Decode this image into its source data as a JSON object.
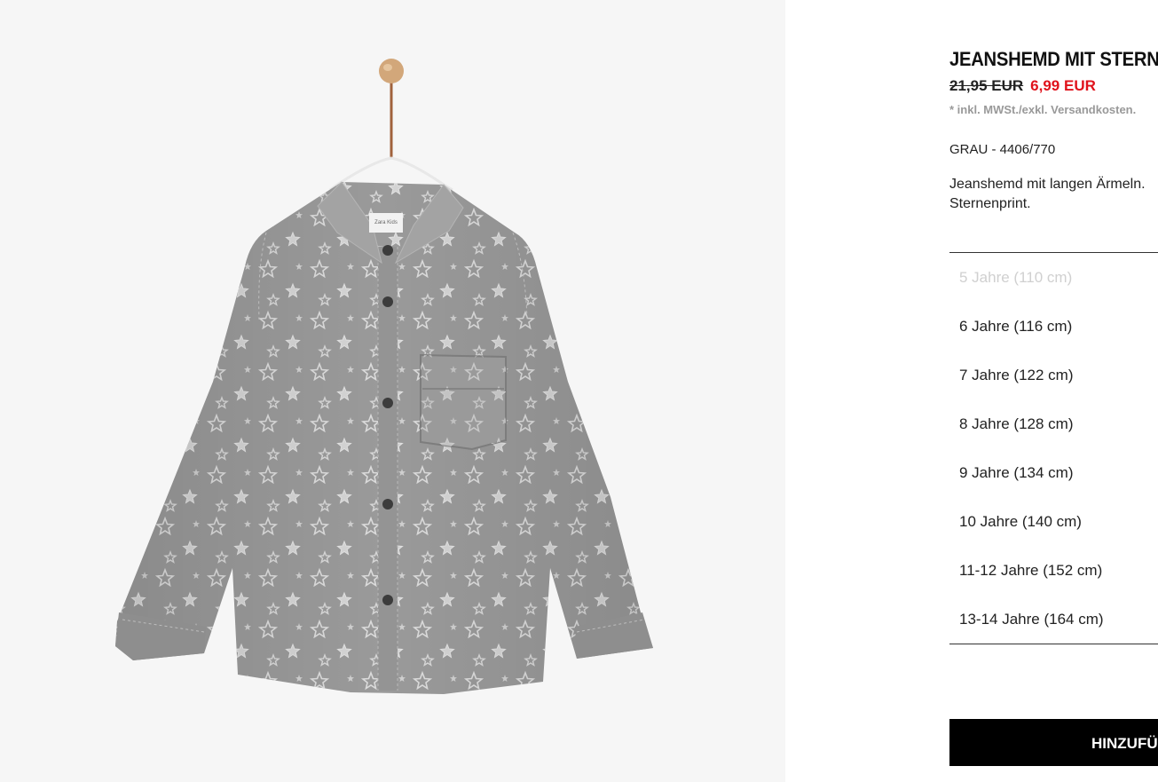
{
  "product": {
    "title": "JEANSHEMD MIT STERNEN",
    "old_price": "21,95 EUR",
    "new_price": "6,99 EUR",
    "tax_note": "* inkl. MWSt./exkl. Versandkosten.",
    "color_ref": "GRAU - 4406/770",
    "description": "Jeanshemd mit langen Ärmeln. Sternenprint.",
    "label_text": "Zara Kids"
  },
  "sizes": [
    {
      "label": "5 Jahre (110 cm)",
      "available": false
    },
    {
      "label": "6 Jahre (116 cm)",
      "available": true
    },
    {
      "label": "7 Jahre (122 cm)",
      "available": true
    },
    {
      "label": "8 Jahre (128 cm)",
      "available": true
    },
    {
      "label": "9 Jahre (134 cm)",
      "available": true
    },
    {
      "label": "10 Jahre (140 cm)",
      "available": true
    },
    {
      "label": "11-12 Jahre (152 cm)",
      "available": true
    },
    {
      "label": "13-14 Jahre (164 cm)",
      "available": true
    }
  ],
  "add_button": {
    "label": "HINZUFÜGEN"
  },
  "colors": {
    "sale": "#e0121b",
    "button_bg": "#000000",
    "shirt": "#9a9a9a",
    "background": "#f6f6f6"
  }
}
